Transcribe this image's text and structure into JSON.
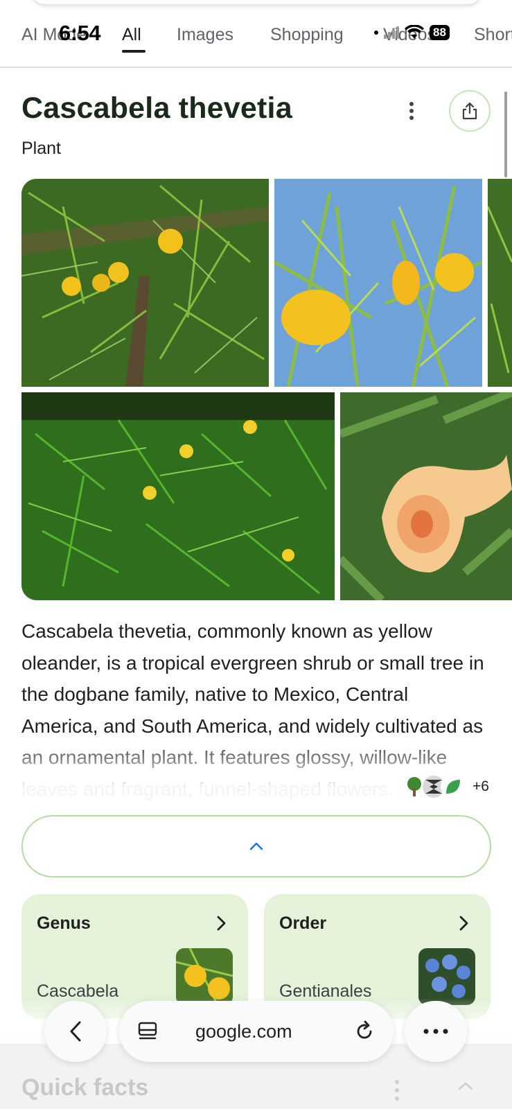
{
  "status_bar": {
    "time": "6:54",
    "battery": "88"
  },
  "tabs": [
    {
      "label": "AI Mode",
      "active": false
    },
    {
      "label": "All",
      "active": true
    },
    {
      "label": "Images",
      "active": false
    },
    {
      "label": "Shopping",
      "active": false
    },
    {
      "label": "Videos",
      "active": false
    },
    {
      "label": "Shorts",
      "active": false
    }
  ],
  "knowledge_panel": {
    "title": "Cascabela thevetia",
    "subtitle": "Plant",
    "description": "Cascabela thevetia, commonly known as yellow oleander, is a tropical evergreen shrub or small tree in the dogbane family, native to Mexico, Central America, and South America, and widely cultivated as an ornamental plant. It features glossy, willow-like leaves and fragrant, funnel-shaped flowers.",
    "sources_more": "+6",
    "cards": [
      {
        "label": "Genus",
        "value": "Cascabela"
      },
      {
        "label": "Order",
        "value": "Gentianales"
      }
    ]
  },
  "next_section": {
    "title": "Quick facts"
  },
  "browser_bar": {
    "url": "google.com"
  },
  "colors": {
    "accent_green_border": "#b8d9a6",
    "card_background": "#e3f2d9",
    "link_blue": "#1a73e8"
  },
  "icons": [
    "more-vert-icon",
    "share-icon",
    "chevron-up-icon",
    "chevron-right-icon",
    "back-arrow-icon",
    "tab-switcher-icon",
    "reload-icon",
    "more-horiz-icon"
  ]
}
